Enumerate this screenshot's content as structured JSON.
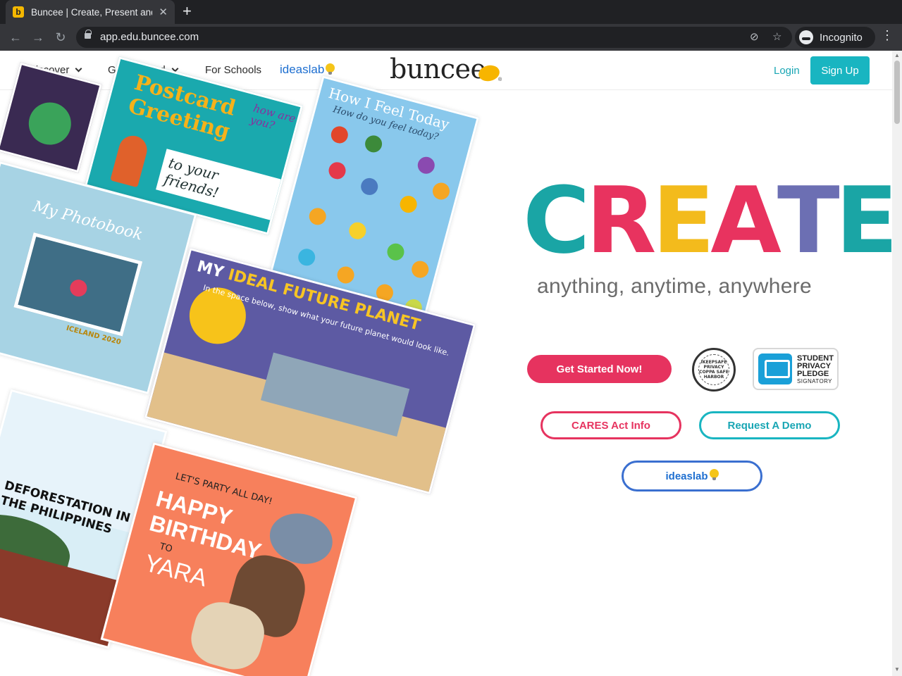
{
  "browser": {
    "tab_title": "Buncee | Create, Present and Share",
    "tab_favicon_letter": "b",
    "new_tab": "+",
    "close": "✕",
    "url": "app.edu.buncee.com",
    "profile_label": "Incognito",
    "menu": "⋮",
    "icons": [
      "back-icon",
      "forward-icon",
      "reload-icon",
      "lock-icon",
      "eye-off-icon",
      "star-icon",
      "incognito-icon",
      "menu-icon"
    ]
  },
  "header": {
    "nav": [
      {
        "label": "Discover",
        "dropdown": true
      },
      {
        "label": "Get Inspired",
        "dropdown": true
      },
      {
        "label": "For Schools",
        "dropdown": false
      }
    ],
    "ideaslab": "ideaslab",
    "brand": "buncee",
    "brand_mark": "®",
    "login": "Login",
    "signup": "Sign Up"
  },
  "collage": {
    "postcard": {
      "title": "Postcard Greeting",
      "subtitle": "to your friends!",
      "aside": "how are you?"
    },
    "feelings": {
      "title": "How I Feel Today",
      "subtitle": "How do you feel today?"
    },
    "photobook": {
      "title": "My Photobook",
      "caption": "ICELAND 2020"
    },
    "planet": {
      "title_a": "MY",
      "title_b": "IDEAL FUTURE PLANET",
      "subtitle": "In the space below, show what your future planet would look like."
    },
    "deforestation": {
      "title": "DEFORESTATION IN THE PHILIPPINES"
    },
    "birthday": {
      "kicker": "LET'S PARTY ALL DAY!",
      "title": "HAPPY BIRTHDAY",
      "to": "TO",
      "name": "YARA"
    }
  },
  "hero": {
    "headline_letters": [
      {
        "char": "C",
        "color": "#1aa5a5"
      },
      {
        "char": "R",
        "color": "#e8335f"
      },
      {
        "char": "E",
        "color": "#f3bb1c"
      },
      {
        "char": "A",
        "color": "#e8335f"
      },
      {
        "char": "T",
        "color": "#6c6fb3"
      },
      {
        "char": "E",
        "color": "#1aa5a5"
      }
    ],
    "tagline": "anything, anytime, anywhere",
    "cta_start": "Get Started Now!",
    "seal_text": "IKEEPSAFE PRIVACY COPPA SAFE HARBOR",
    "pledge_line1": "STUDENT",
    "pledge_line2": "PRIVACY",
    "pledge_line3": "PLEDGE",
    "pledge_line4": "SIGNATORY",
    "cta_cares": "CARES Act Info",
    "cta_demo": "Request A Demo",
    "cta_ideaslab": "ideaslab"
  },
  "colors": {
    "teal": "#19b5c1",
    "pink": "#e6335f",
    "yellow": "#f7b500",
    "blue": "#1e6fd0"
  }
}
